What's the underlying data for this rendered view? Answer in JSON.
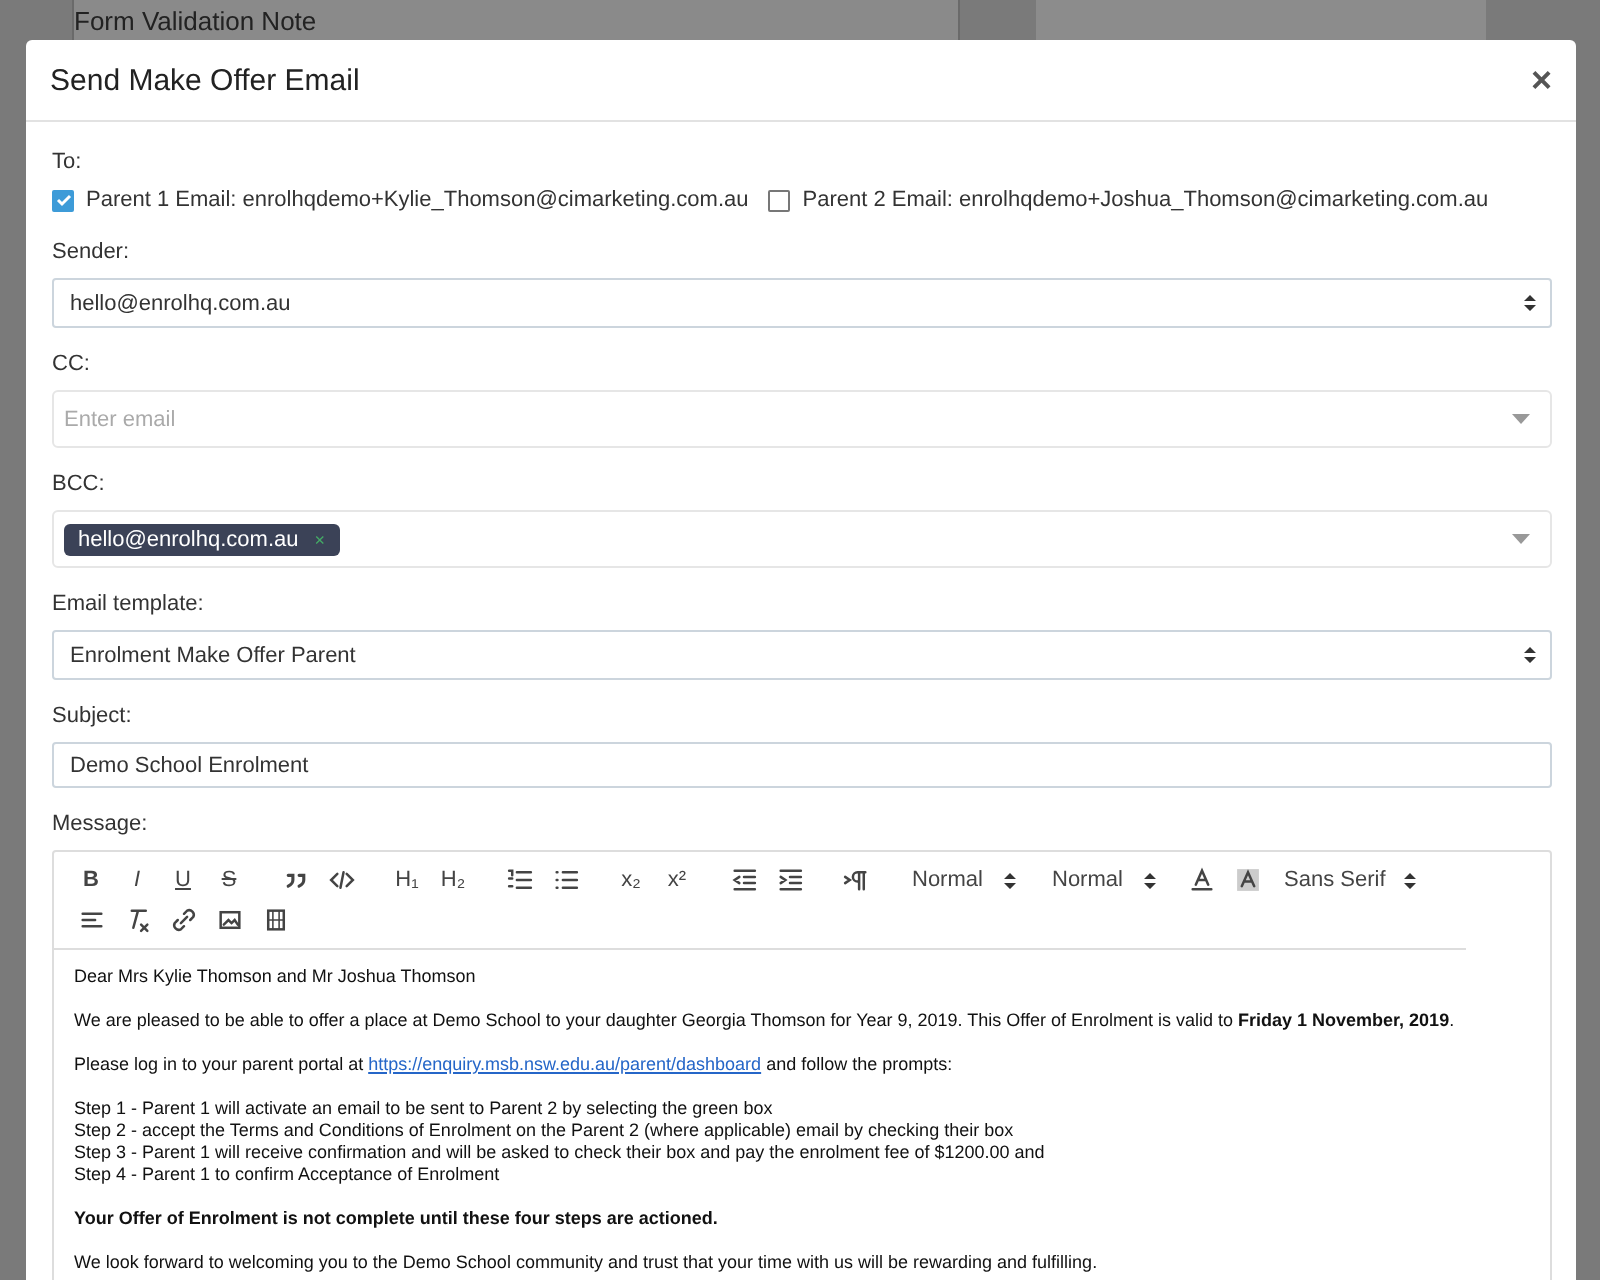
{
  "background": {
    "left_heading": "Form Validation Note"
  },
  "modal": {
    "title": "Send Make Offer Email",
    "close": "×"
  },
  "to": {
    "label": "To:",
    "recipients": [
      {
        "label": "Parent 1 Email: enrolhqdemo+Kylie_Thomson@cimarketing.com.au",
        "checked": true
      },
      {
        "label": "Parent 2 Email: enrolhqdemo+Joshua_Thomson@cimarketing.com.au",
        "checked": false
      }
    ]
  },
  "sender": {
    "label": "Sender:",
    "value": "hello@enrolhq.com.au"
  },
  "cc": {
    "label": "CC:",
    "placeholder": "Enter email"
  },
  "bcc": {
    "label": "BCC:",
    "tags": [
      "hello@enrolhq.com.au"
    ],
    "tag_remove": "×"
  },
  "email_template": {
    "label": "Email template:",
    "value": "Enrolment Make Offer Parent"
  },
  "subject": {
    "label": "Subject:",
    "value": "Demo School Enrolment"
  },
  "message": {
    "label": "Message:",
    "toolbar": [
      {
        "kind": "bold",
        "text": "B"
      },
      {
        "kind": "italic",
        "text": "I"
      },
      {
        "kind": "underline",
        "text": "U"
      },
      {
        "kind": "strike",
        "text": "S"
      },
      {
        "kind": "quote"
      },
      {
        "kind": "code"
      },
      {
        "kind": "plain",
        "text": "H₁"
      },
      {
        "kind": "plain",
        "text": "H₂"
      },
      {
        "kind": "ordered-list"
      },
      {
        "kind": "bullet-list"
      },
      {
        "kind": "plain",
        "text": "x₂"
      },
      {
        "kind": "plain",
        "text": "x²"
      },
      {
        "kind": "outdent"
      },
      {
        "kind": "indent"
      },
      {
        "kind": "direction"
      },
      {
        "kind": "picker",
        "text": "Normal"
      },
      {
        "kind": "picker",
        "text": "Normal"
      },
      {
        "kind": "text-color"
      },
      {
        "kind": "highlight"
      },
      {
        "kind": "picker",
        "text": "Sans Serif"
      },
      {
        "kind": "align"
      },
      {
        "kind": "clear-format"
      },
      {
        "kind": "link"
      },
      {
        "kind": "image"
      },
      {
        "kind": "video"
      }
    ],
    "body": [
      {
        "kind": "text",
        "text": "Dear Mrs Kylie Thomson and Mr Joshua Thomson"
      },
      {
        "kind": "text",
        "text": "We are pleased to be able to offer a place at Demo School to your daughter Georgia Thomson for Year 9, 2019. This Offer of Enrolment is valid to **Friday 1 November, 2019**."
      },
      {
        "kind": "link",
        "before": "Please log in to your parent portal at ",
        "link": "https://enquiry.msb.nsw.edu.au/parent/dashboard",
        "after": " and follow the prompts:"
      },
      {
        "kind": "lines",
        "lines": [
          "Step 1 - Parent 1 will activate an email to be sent to Parent 2 by selecting the green box",
          "Step 2 - accept the Terms and Conditions of Enrolment on the Parent 2 (where applicable) email by checking their box",
          "Step 3 - Parent 1 will receive confirmation and will be asked to check their box and pay the enrolment fee of $1200.00 and",
          "Step 4 - Parent 1 to confirm Acceptance of Enrolment"
        ]
      },
      {
        "kind": "emphasis",
        "text": "Your Offer of Enrolment is not complete until these four steps are actioned."
      },
      {
        "kind": "text",
        "text": "We look forward to welcoming you to the Demo School community and trust that your time with us will be rewarding and fulfilling."
      }
    ]
  }
}
